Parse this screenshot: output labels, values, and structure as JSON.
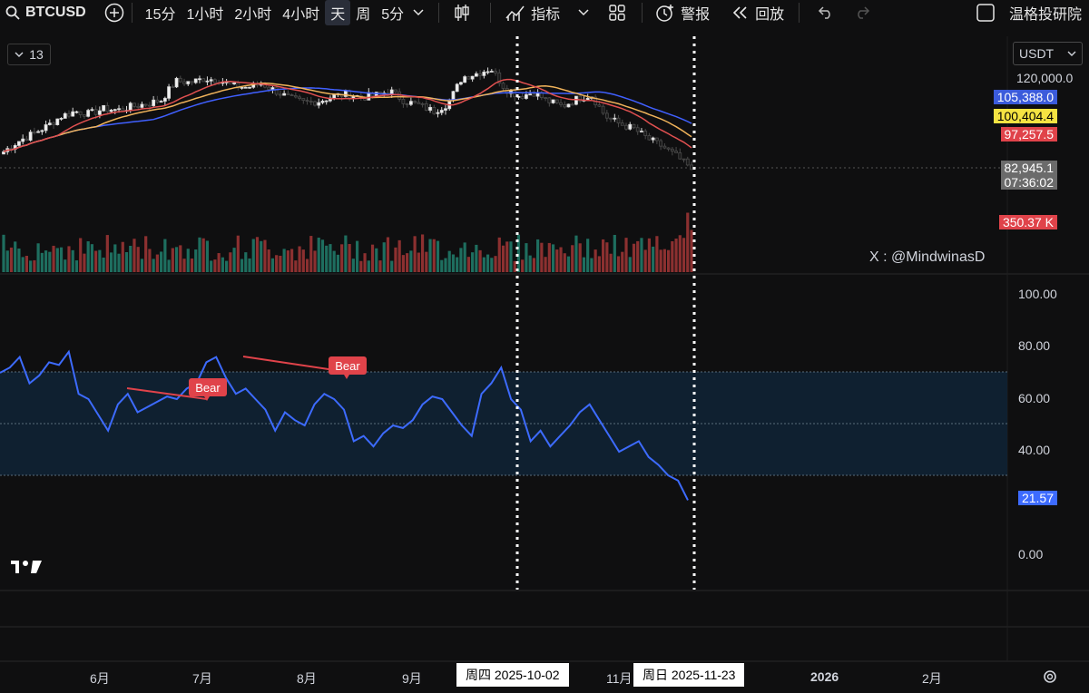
{
  "toolbar": {
    "symbol": "BTCUSD",
    "intervals": [
      "15分",
      "1小时",
      "2小时",
      "4小时",
      "天",
      "周",
      "5分"
    ],
    "active_interval": "天",
    "indicators_label": "指标",
    "alert_label": "警报",
    "replay_label": "回放",
    "user_label": "温格投研院"
  },
  "chart_header": {
    "interval_box": "13",
    "currency": "USDT"
  },
  "price_axis": {
    "top_label": "120,000.0",
    "tags": [
      {
        "label": "105,388.0",
        "color": "#3b5bdb",
        "text": "#ffffff"
      },
      {
        "label": "100,404.4",
        "color": "#f5e342",
        "text": "#000000"
      },
      {
        "label": "97,257.5",
        "color": "#e0434a",
        "text": "#ffffff"
      },
      {
        "label": "82,945.1",
        "color": "#6b6b6b",
        "text": "#ffffff"
      },
      {
        "label": "07:36:02",
        "color": "#6b6b6b",
        "text": "#ffffff"
      },
      {
        "label": "350.37 K",
        "color": "#e0434a",
        "text": "#ffffff"
      }
    ]
  },
  "watermark": "X : @MindwinasD",
  "rsi": {
    "levels": [
      "100.00",
      "80.00",
      "60.00",
      "40.00",
      "0.00"
    ],
    "current": "21.57",
    "bear_labels": [
      "Bear",
      "Bear"
    ]
  },
  "time_axis": {
    "months": [
      "6月",
      "7月",
      "8月",
      "9月",
      "11月",
      "2026",
      "2月"
    ],
    "highlight_dates": [
      "周四 2025-10-02",
      "周日 2025-11-23"
    ]
  },
  "colors": {
    "up": "#26a69a",
    "down": "#ef5350",
    "rsi": "#3d6bff",
    "bear": "#e0434a",
    "ma_orange": "#f0b35a",
    "ma_red": "#e05050",
    "ma_blue": "#4060ff"
  },
  "chart_data": {
    "type": "line",
    "price_close": [
      90000,
      94000,
      97000,
      100000,
      104000,
      106000,
      105000,
      107000,
      106500,
      108000,
      109000,
      110500,
      118000,
      117500,
      119000,
      118500,
      116000,
      115500,
      117000,
      114000,
      111000,
      109500,
      110000,
      112000,
      113000,
      111500,
      112500,
      114000,
      110000,
      108500,
      106000,
      109000,
      119500,
      121000,
      123000,
      115000,
      112000,
      113500,
      110000,
      108000,
      111000,
      112500,
      104000,
      101000,
      99000,
      95000,
      92000,
      88000,
      82945.1
    ],
    "ma_values": {
      "blue": 105388.0,
      "yellow": 100404.4,
      "red": 97257.5
    },
    "last_volume": "350.37 K",
    "rsi_values": [
      70,
      72,
      76,
      66,
      69,
      74,
      73,
      78,
      62,
      60,
      54,
      48,
      58,
      62,
      55,
      57,
      59,
      61,
      60,
      64,
      66,
      74,
      76,
      68,
      62,
      64,
      60,
      56,
      48,
      55,
      52,
      50,
      58,
      62,
      60,
      56,
      44,
      46,
      42,
      47,
      50,
      49,
      52,
      58,
      61,
      60,
      55,
      50,
      46,
      62,
      66,
      72,
      60,
      56,
      44,
      48,
      42,
      46,
      50,
      55,
      58,
      52,
      46,
      40,
      42,
      44,
      38,
      35,
      31,
      29,
      21.57
    ],
    "ylim_rsi": [
      0,
      100
    ],
    "rsi_band": [
      30,
      70
    ]
  }
}
